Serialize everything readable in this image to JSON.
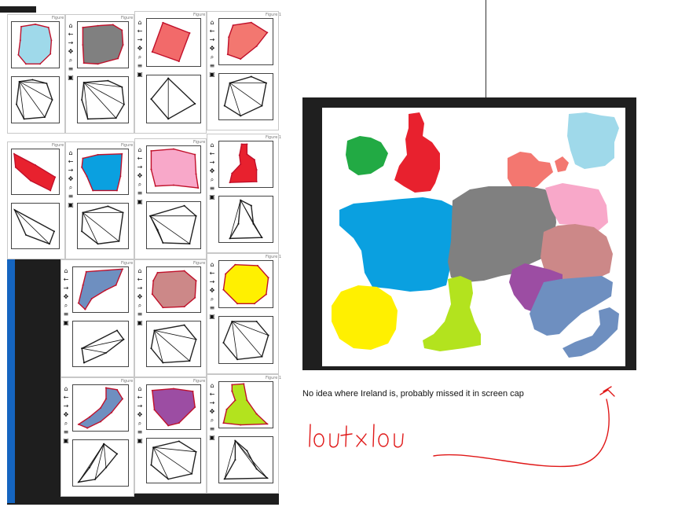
{
  "caption": "No idea where Ireland is, probably missed it in screen cap",
  "handwriting": "lout lou",
  "figure_window_title": "Figure 1",
  "toolbar_icons": [
    "home-icon",
    "back-icon",
    "forward-icon",
    "pan-icon",
    "zoom-icon",
    "configure-icon",
    "save-icon"
  ],
  "colors": {
    "light_blue": "#9fd9ea",
    "gray": "#808080",
    "red_orange": "#f26a6a",
    "salmon": "#f37770",
    "red": "#e8212e",
    "blue": "#0aa0e0",
    "pink": "#f8a8c9",
    "steel_blue": "#6e8fc0",
    "rose_brown": "#cc8888",
    "yellow": "#fff000",
    "purple": "#9c4da3",
    "lime": "#b3e31e",
    "green": "#22aa44",
    "annotation_red": "#e01818"
  }
}
